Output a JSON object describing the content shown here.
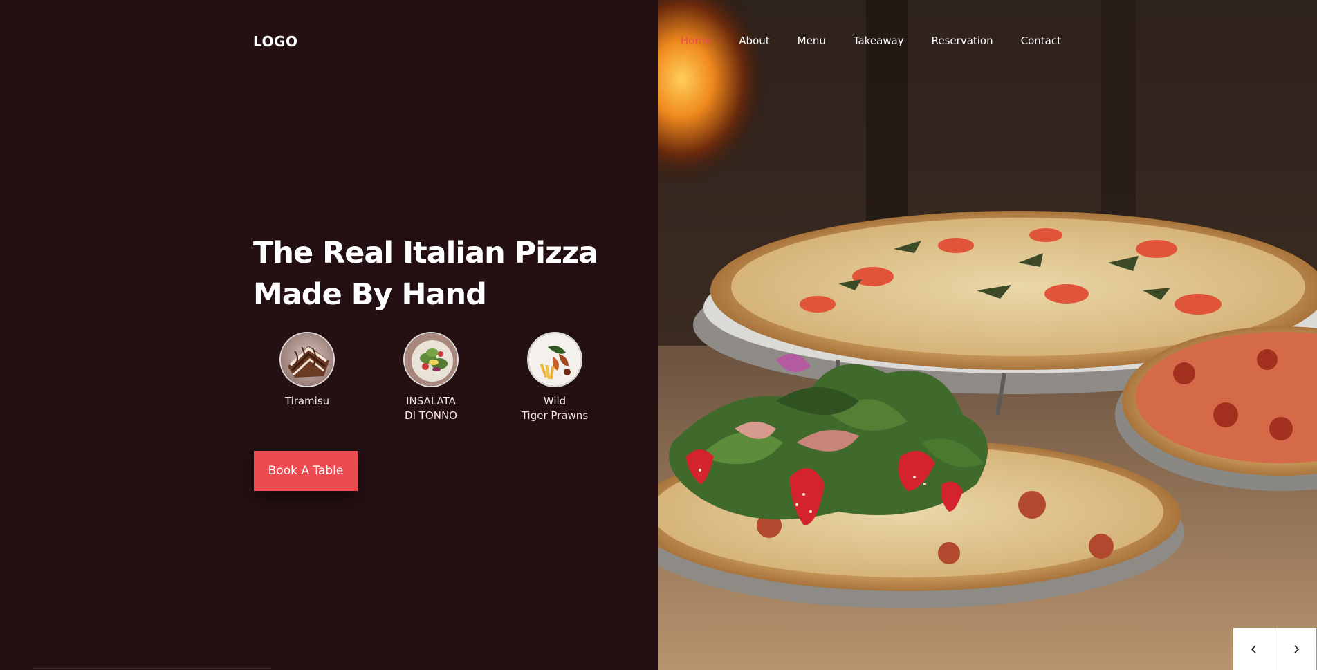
{
  "brand": {
    "logo": "LOGO"
  },
  "nav": {
    "items": [
      {
        "label": "Home",
        "active": true
      },
      {
        "label": "About",
        "active": false
      },
      {
        "label": "Menu",
        "active": false
      },
      {
        "label": "Takeaway",
        "active": false
      },
      {
        "label": "Reservation",
        "active": false
      },
      {
        "label": "Contact",
        "active": false
      }
    ]
  },
  "hero": {
    "headline_line1": "The Real Italian Pizza",
    "headline_line2": "Made By Hand",
    "cta_label": "Book A Table"
  },
  "dishes": [
    {
      "line1": "Tiramisu",
      "line2": "",
      "icon": "tiramisu-image"
    },
    {
      "line1": "INSALATA",
      "line2": "DI TONNO",
      "icon": "salad-image"
    },
    {
      "line1": "Wild",
      "line2": "Tiger Prawns",
      "icon": "prawns-image"
    }
  ],
  "slider": {
    "prev_icon": "chevron-left-icon",
    "next_icon": "chevron-right-icon"
  },
  "colors": {
    "background": "#240f12",
    "accent": "#ee4a52",
    "text": "#ffffff"
  }
}
